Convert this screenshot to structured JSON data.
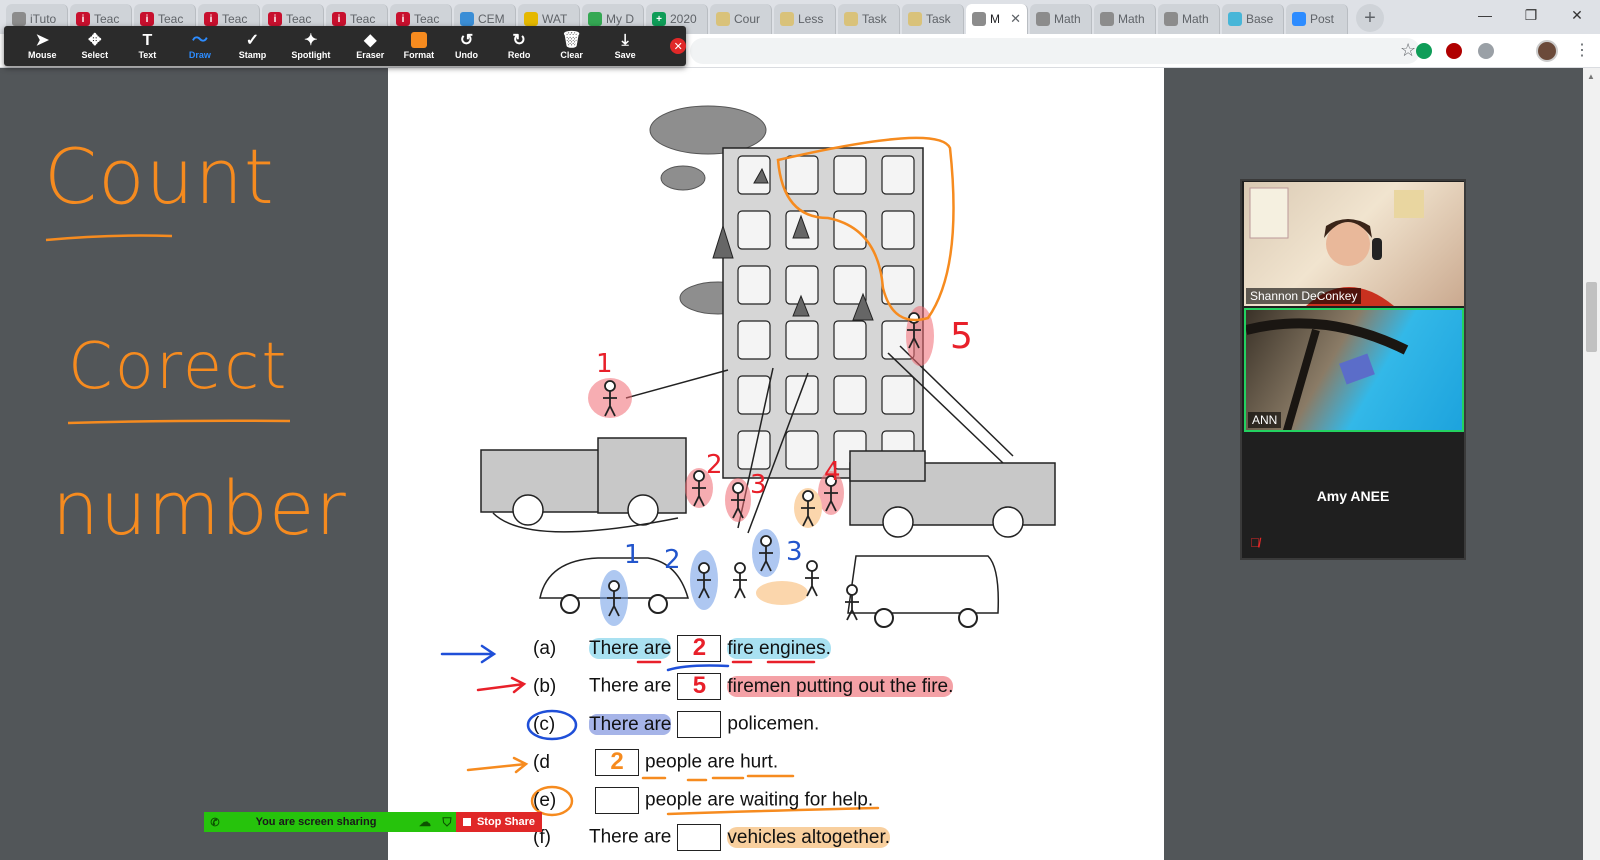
{
  "browser": {
    "tabs": [
      {
        "title": "iTuto",
        "fav_color": "#8c8c8c",
        "fav_char": ""
      },
      {
        "title": "Teac",
        "fav_color": "#c8102e",
        "fav_char": "i"
      },
      {
        "title": "Teac",
        "fav_color": "#c8102e",
        "fav_char": "i"
      },
      {
        "title": "Teac",
        "fav_color": "#c8102e",
        "fav_char": "i"
      },
      {
        "title": "Teac",
        "fav_color": "#c8102e",
        "fav_char": "i"
      },
      {
        "title": "Teac",
        "fav_color": "#c8102e",
        "fav_char": "i"
      },
      {
        "title": "Teac",
        "fav_color": "#c8102e",
        "fav_char": "i"
      },
      {
        "title": "CEM",
        "fav_color": "#3b8ed6",
        "fav_char": ""
      },
      {
        "title": "WAT",
        "fav_color": "#e5b800",
        "fav_char": ""
      },
      {
        "title": "My D",
        "fav_color": "#34a853",
        "fav_char": ""
      },
      {
        "title": "2020",
        "fav_color": "#0f9d58",
        "fav_char": "+"
      },
      {
        "title": "Cour",
        "fav_color": "#d9c27a",
        "fav_char": ""
      },
      {
        "title": "Less",
        "fav_color": "#d9c27a",
        "fav_char": ""
      },
      {
        "title": "Task",
        "fav_color": "#d9c27a",
        "fav_char": ""
      },
      {
        "title": "Task",
        "fav_color": "#d9c27a",
        "fav_char": ""
      },
      {
        "title": "M",
        "fav_color": "#8c8c8c",
        "fav_char": "",
        "active": true
      },
      {
        "title": "Math",
        "fav_color": "#8c8c8c",
        "fav_char": ""
      },
      {
        "title": "Math",
        "fav_color": "#8c8c8c",
        "fav_char": ""
      },
      {
        "title": "Math",
        "fav_color": "#8c8c8c",
        "fav_char": ""
      },
      {
        "title": "Base",
        "fav_color": "#47b6d8",
        "fav_char": ""
      },
      {
        "title": "Post",
        "fav_color": "#2d8cff",
        "fav_char": ""
      }
    ],
    "new_tab": "+",
    "close_tab": "✕",
    "min": "—",
    "restore": "❐",
    "close": "✕",
    "star": "☆",
    "menu": "⋮",
    "extensions": [
      {
        "name": "green-extension-icon",
        "color": "#0f9d58"
      },
      {
        "name": "ublock-extension-icon",
        "color": "#b00000"
      },
      {
        "name": "puzzle-extension-icon",
        "color": "#9aa0a6"
      }
    ]
  },
  "annotate_toolbar": {
    "tools": [
      {
        "name": "mouse",
        "label": "Mouse",
        "icon": "➤"
      },
      {
        "name": "select",
        "label": "Select",
        "icon": "✥"
      },
      {
        "name": "text",
        "label": "Text",
        "icon": "T"
      },
      {
        "name": "draw",
        "label": "Draw",
        "icon": "〜",
        "selected": true
      },
      {
        "name": "stamp",
        "label": "Stamp",
        "icon": "✓"
      },
      {
        "name": "spotlight",
        "label": "Spotlight",
        "icon": "✦"
      },
      {
        "name": "eraser",
        "label": "Eraser",
        "icon": "◆"
      },
      {
        "name": "format",
        "label": "Format",
        "icon": ""
      },
      {
        "name": "undo",
        "label": "Undo",
        "icon": "↺"
      },
      {
        "name": "redo",
        "label": "Redo",
        "icon": "↻"
      },
      {
        "name": "clear",
        "label": "Clear",
        "icon": "🗑"
      },
      {
        "name": "save",
        "label": "Save",
        "icon": "⤓"
      }
    ],
    "format_color": "#f68b1f",
    "close": "✕"
  },
  "notes": {
    "word1": "Count",
    "word2": "Corect",
    "word3": "number"
  },
  "marks": {
    "fire_numbers": [
      "1",
      "2",
      "3",
      "4",
      "5"
    ],
    "police_numbers": [
      "1",
      "2",
      "3"
    ]
  },
  "worksheet": {
    "questions": [
      {
        "label": "(a)",
        "before": "There are",
        "answer": "2",
        "after": "fire engines."
      },
      {
        "label": "(b)",
        "before": "There are",
        "answer": "5",
        "after": "firemen putting out the fire."
      },
      {
        "label": "(c)",
        "before": "There are",
        "answer": "",
        "after": "policemen."
      },
      {
        "label": "(d",
        "before": "",
        "answer": "2",
        "after": "people are hurt."
      },
      {
        "label": "(e)",
        "before": "",
        "answer": "",
        "after": "people are waiting for help."
      },
      {
        "label": "(f)",
        "before": "There are",
        "answer": "",
        "after": "vehicles altogether."
      }
    ]
  },
  "participants": [
    {
      "name": "Shannon DeConkey",
      "video": true
    },
    {
      "name": "ANN",
      "video": true
    },
    {
      "name": "Amy ANEE",
      "video": false,
      "muted": true
    }
  ],
  "share_bar": {
    "status": "You are screen sharing",
    "stop": "Stop Share"
  }
}
